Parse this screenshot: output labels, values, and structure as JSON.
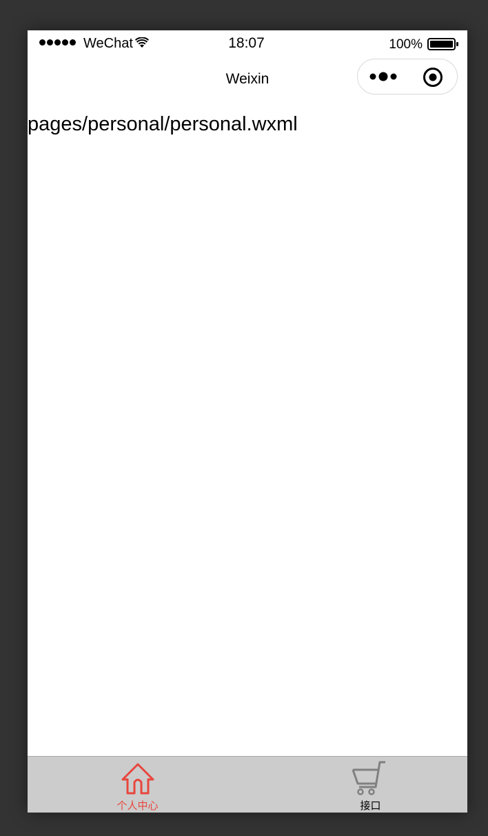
{
  "status_bar": {
    "carrier": "WeChat",
    "time": "18:07",
    "battery_percent": "100%",
    "icons": [
      "signal-dots-icon",
      "wifi-icon",
      "battery-icon"
    ]
  },
  "nav_bar": {
    "title": "Weixin",
    "capsule_icons": [
      "more-icon",
      "close-target-icon"
    ]
  },
  "content": {
    "page_path": "pages/personal/personal.wxml"
  },
  "tab_bar": {
    "tabs": [
      {
        "label": "个人中心",
        "icon": "house-icon",
        "active": true
      },
      {
        "label": "接口",
        "icon": "cart-icon",
        "active": false
      }
    ],
    "colors": {
      "active": "#e8463d",
      "inactive": "#000000",
      "background": "#cccccc"
    }
  }
}
